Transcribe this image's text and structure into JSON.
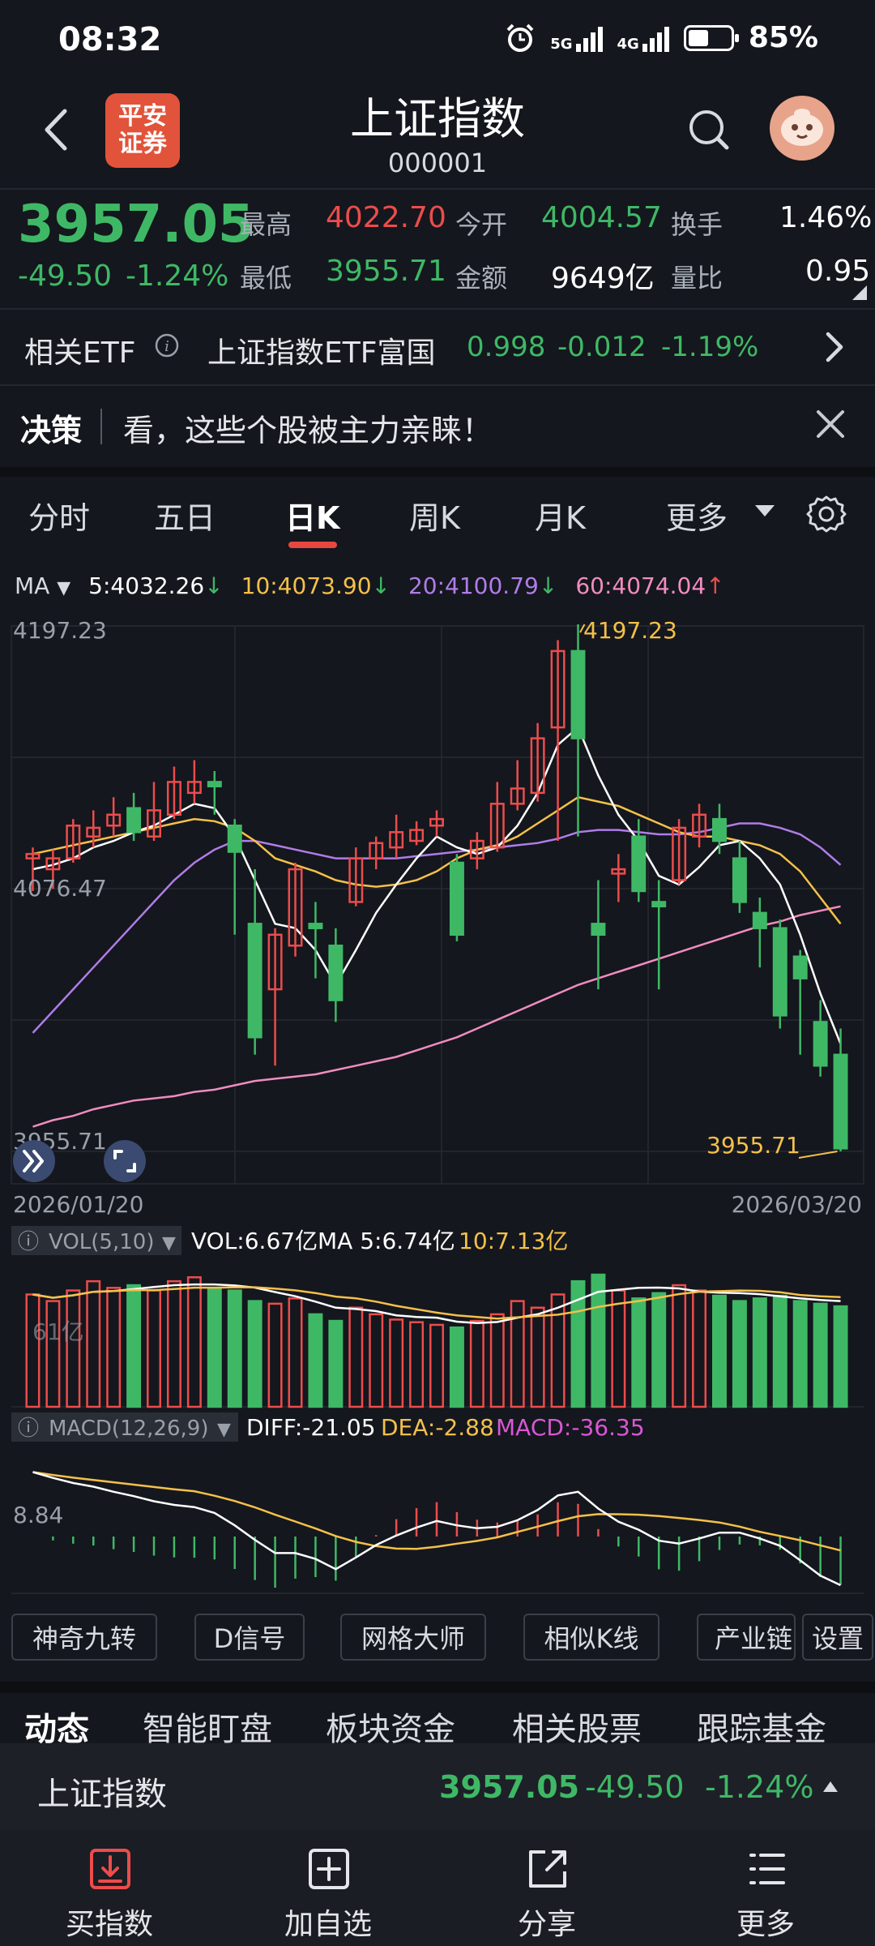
{
  "status": {
    "time": "08:32",
    "network1": "5G",
    "network2": "4G",
    "battery": "85%",
    "battery_level": 0.85
  },
  "header": {
    "logo_line1": "平安",
    "logo_line2": "证券",
    "title": "上证指数",
    "code": "000001"
  },
  "quote": {
    "price": "3957.05",
    "change": "-49.50",
    "change_pct": "-1.24%",
    "stats": [
      {
        "label": "最高",
        "value": "4022.70",
        "color": "#ec4c4c"
      },
      {
        "label": "今开",
        "value": "4004.57",
        "color": "#3fb866"
      },
      {
        "label": "换手",
        "value": "1.46%",
        "color": "#ffffff"
      },
      {
        "label": "最低",
        "value": "3955.71",
        "color": "#3fb866"
      },
      {
        "label": "金额",
        "value": "9649亿",
        "color": "#ffffff"
      },
      {
        "label": "量比",
        "value": "0.95",
        "color": "#ffffff"
      }
    ]
  },
  "etf": {
    "label": "相关ETF",
    "name": "上证指数ETF富国",
    "price": "0.998",
    "change": "-0.012",
    "change_pct": "-1.19%"
  },
  "banner": {
    "tag": "决策",
    "text": "看，这些个股被主力亲睐！"
  },
  "kline_tabs": [
    {
      "label": "分时"
    },
    {
      "label": "五日"
    },
    {
      "label": "日K"
    },
    {
      "label": "周K"
    },
    {
      "label": "月K"
    },
    {
      "label": "更多"
    }
  ],
  "ma_legend": {
    "label": "MA",
    "ma5": "5:4032.26",
    "ma10": "10:4073.90",
    "ma20": "20:4100.79",
    "ma60": "60:4074.04"
  },
  "colors": {
    "up": "#ec4c4c",
    "down": "#3fb866",
    "ma5": "#ffffff",
    "ma10": "#f5c04a",
    "ma20": "#b07ce8",
    "ma60": "#f08cc0",
    "accent": "#e8473f"
  },
  "chart_data": {
    "type": "candlestick",
    "x_start": "2026/01/20",
    "x_end": "2026/03/20",
    "y_top_label": "4197.23",
    "y_mid_label": "4076.47",
    "y_bottom_label": "3955.71",
    "ylim": [
      3955.71,
      4197.23
    ],
    "high_annotation": "4197.23",
    "low_annotation": "3955.71",
    "candles": [
      [
        4090,
        4092,
        4075,
        4095
      ],
      [
        4085,
        4090,
        4076,
        4094
      ],
      [
        4090,
        4105,
        4088,
        4108
      ],
      [
        4100,
        4104,
        4095,
        4112
      ],
      [
        4105,
        4110,
        4100,
        4118
      ],
      [
        4113,
        4102,
        4098,
        4120
      ],
      [
        4100,
        4112,
        4098,
        4125
      ],
      [
        4110,
        4125,
        4108,
        4132
      ],
      [
        4120,
        4125,
        4115,
        4135
      ],
      [
        4125,
        4123,
        4110,
        4130
      ],
      [
        4105,
        4093,
        4055,
        4108
      ],
      [
        4060,
        4008,
        4000,
        4085
      ],
      [
        4030,
        4055,
        3995,
        4058
      ],
      [
        4050,
        4085,
        4045,
        4088
      ],
      [
        4060,
        4058,
        4035,
        4070
      ],
      [
        4050,
        4025,
        4015,
        4058
      ],
      [
        4070,
        4090,
        4068,
        4095
      ],
      [
        4090,
        4097,
        4085,
        4100
      ],
      [
        4095,
        4102,
        4090,
        4110
      ],
      [
        4098,
        4103,
        4096,
        4107
      ],
      [
        4105,
        4108,
        4100,
        4112
      ],
      [
        4088,
        4055,
        4052,
        4092
      ],
      [
        4090,
        4098,
        4085,
        4102
      ],
      [
        4095,
        4115,
        4093,
        4125
      ],
      [
        4115,
        4122,
        4112,
        4135
      ],
      [
        4120,
        4145,
        4116,
        4152
      ],
      [
        4150,
        4185,
        4098,
        4190
      ],
      [
        4185,
        4145,
        4100,
        4197.23
      ],
      [
        4060,
        4055,
        4030,
        4080
      ],
      [
        4083,
        4085,
        4070,
        4092
      ],
      [
        4100,
        4075,
        4070,
        4108
      ],
      [
        4070,
        4068,
        4030,
        4080
      ],
      [
        4080,
        4104,
        4078,
        4108
      ],
      [
        4100,
        4110,
        4095,
        4115
      ],
      [
        4108,
        4098,
        4092,
        4115
      ],
      [
        4090,
        4070,
        4065,
        4098
      ],
      [
        4065,
        4058,
        4040,
        4072
      ],
      [
        4058,
        4018,
        4012,
        4062
      ],
      [
        4045,
        4035,
        4000,
        4048
      ],
      [
        4015,
        3995,
        3990,
        4025
      ],
      [
        4000,
        3957.05,
        3955.71,
        4012
      ]
    ],
    "ma5": [
      4085,
      4087,
      4090,
      4095,
      4098,
      4102,
      4105,
      4110,
      4115,
      4113,
      4100,
      4080,
      4060,
      4058,
      4048,
      4032,
      4048,
      4065,
      4078,
      4090,
      4100,
      4095,
      4092,
      4095,
      4105,
      4120,
      4142,
      4150,
      4128,
      4110,
      4098,
      4082,
      4078,
      4086,
      4096,
      4098,
      4090,
      4078,
      4055,
      4028,
      4005
    ],
    "ma10": [
      4092,
      4094,
      4096,
      4098,
      4100,
      4102,
      4104,
      4106,
      4108,
      4107,
      4104,
      4098,
      4090,
      4087,
      4084,
      4080,
      4078,
      4077,
      4078,
      4080,
      4084,
      4090,
      4094,
      4096,
      4100,
      4106,
      4112,
      4118,
      4116,
      4114,
      4110,
      4106,
      4102,
      4100,
      4100,
      4098,
      4096,
      4092,
      4084,
      4072,
      4060
    ],
    "ma20": [
      4010,
      4020,
      4030,
      4040,
      4050,
      4060,
      4070,
      4080,
      4088,
      4094,
      4098,
      4098,
      4096,
      4094,
      4092,
      4090,
      4090,
      4090,
      4090,
      4091,
      4092,
      4093,
      4094,
      4095,
      4096,
      4097,
      4099,
      4102,
      4103,
      4103,
      4102,
      4101,
      4101,
      4102,
      4104,
      4106,
      4106,
      4104,
      4101,
      4095,
      4087
    ],
    "ma60": [
      3967,
      3970,
      3972,
      3975,
      3977,
      3979,
      3980,
      3981,
      3983,
      3984,
      3986,
      3988,
      3989,
      3990,
      3991,
      3993,
      3995,
      3997,
      3999,
      4002,
      4005,
      4008,
      4012,
      4016,
      4020,
      4024,
      4028,
      4032,
      4035,
      4038,
      4041,
      4044,
      4047,
      4050,
      4053,
      4056,
      4059,
      4061,
      4064,
      4066,
      4068
    ],
    "volume_legend": {
      "label": "VOL(5,10)",
      "vol": "VOL:6.67亿",
      "ma5": "MA 5:6.74亿",
      "ma10": "10:7.13亿",
      "axis_label": "61亿"
    },
    "macd_legend": {
      "label": "MACD(12,26,9)",
      "diff": "DIFF:-21.05",
      "dea": "DEA:-2.88",
      "macd": "MACD:-36.35",
      "axis_label": "8.84"
    },
    "volumes": [
      0.85,
      0.8,
      0.88,
      0.95,
      0.9,
      0.92,
      0.88,
      0.95,
      0.98,
      0.9,
      0.88,
      0.8,
      0.78,
      0.82,
      0.7,
      0.65,
      0.75,
      0.7,
      0.66,
      0.64,
      0.62,
      0.6,
      0.65,
      0.7,
      0.8,
      0.75,
      0.85,
      0.95,
      1.0,
      0.88,
      0.82,
      0.86,
      0.92,
      0.88,
      0.84,
      0.8,
      0.82,
      0.84,
      0.8,
      0.78,
      0.76
    ]
  },
  "tools": [
    "神奇九转",
    "D信号",
    "网格大师",
    "相似K线",
    "产业链",
    "设置"
  ],
  "news_tabs": [
    "动态",
    "智能盯盘",
    "板块资金",
    "相关股票",
    "跟踪基金"
  ],
  "index_bar": {
    "name": "上证指数",
    "price": "3957.05",
    "change": "-49.50",
    "change_pct": "-1.24%"
  },
  "bottom_nav": [
    {
      "label": "买指数",
      "icon": "download-icon"
    },
    {
      "label": "加自选",
      "icon": "add-watchlist-icon"
    },
    {
      "label": "分享",
      "icon": "share-icon"
    },
    {
      "label": "更多",
      "icon": "menu-icon"
    }
  ]
}
